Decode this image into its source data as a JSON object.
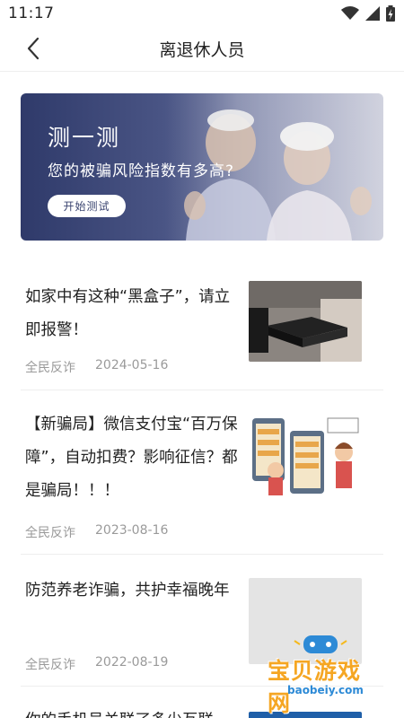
{
  "status_bar": {
    "time": "11:17"
  },
  "header": {
    "title": "离退休人员"
  },
  "banner": {
    "title": "测一测",
    "subtitle": "您的被骗风险指数有多高?",
    "button_label": "开始测试"
  },
  "articles": [
    {
      "title": "如家中有这种“黑盒子”，请立即报警！",
      "source": "全民反诈",
      "date": "2024-05-16",
      "thumb": "black-box-photo"
    },
    {
      "title": "【新骗局】微信支付宝“百万保障”，自动扣费？影响征信？都是骗局！！！",
      "source": "全民反诈",
      "date": "2023-08-16",
      "thumb": "cartoon-phones-illustration"
    },
    {
      "title": "防范养老诈骗，共护幸福晚年",
      "source": "全民反诈",
      "date": "2022-08-19",
      "thumb": "blank-gray"
    },
    {
      "title": "你的手机号关联了多少互联",
      "source": "",
      "date": "",
      "thumb": "blue-card"
    }
  ],
  "watermark": {
    "name": "宝贝游戏网",
    "url": "baobeiy.com"
  }
}
